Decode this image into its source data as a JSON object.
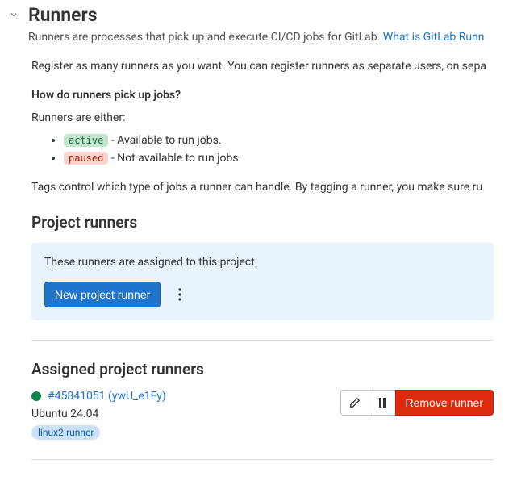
{
  "header": {
    "title": "Runners",
    "subtitle": "Runners are processes that pick up and execute CI/CD jobs for GitLab. ",
    "link_text": "What is GitLab Runn"
  },
  "intro": {
    "register": "Register as many runners as you want. You can register runners as separate users, on sepa",
    "howHeading": "How do runners pick up jobs?",
    "either": "Runners are either:",
    "bullets": [
      {
        "badge": "active",
        "text": " - Available to run jobs."
      },
      {
        "badge": "paused",
        "text": " - Not available to run jobs."
      }
    ],
    "tags": "Tags control which type of jobs a runner can handle. By tagging a runner, you make sure ru"
  },
  "projectRunners": {
    "heading": "Project runners",
    "boxText": "These runners are assigned to this project.",
    "newBtn": "New project runner"
  },
  "assigned": {
    "heading": "Assigned project runners",
    "runner": {
      "id": "#45841051 (ywU_e1Fy)",
      "desc": "Ubuntu 24.04",
      "tag": "linux2-runner"
    },
    "removeBtn": "Remove runner"
  }
}
